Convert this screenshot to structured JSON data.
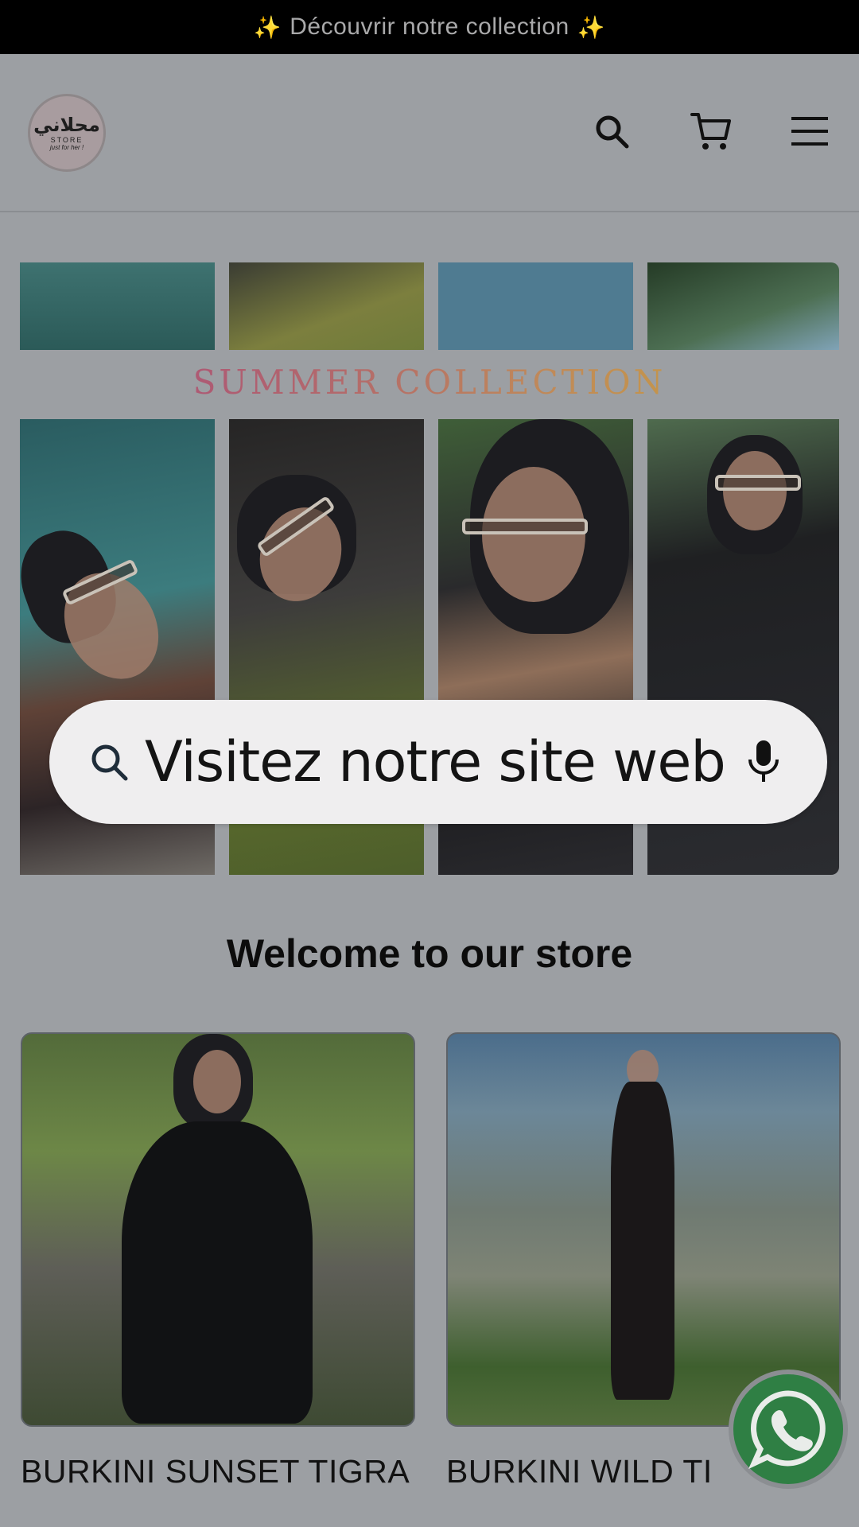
{
  "announcement": {
    "left_icon": "sparkles-icon",
    "text": "Découvrir notre collection",
    "right_icon": "sparkles-icon"
  },
  "header": {
    "logo": {
      "arabic": "محلاني",
      "store": "STORE",
      "tagline": "just for her !"
    },
    "icons": [
      "search-icon",
      "cart-icon",
      "menu-icon"
    ]
  },
  "hero": {
    "banner_text": "SUMMER COLLECTION",
    "search_overlay": {
      "text": "Visitez notre site web",
      "left_icon": "search-icon",
      "right_icon": "microphone-icon"
    }
  },
  "section": {
    "title": "Welcome to our store"
  },
  "products": [
    {
      "title": "BURKINI SUNSET TIGRA"
    },
    {
      "title": "BURKINI WILD TI"
    }
  ],
  "floating": {
    "icon": "whatsapp-icon"
  },
  "colors": {
    "announcement_bg": "#000000",
    "page_overlay": "#9c9fa3",
    "whatsapp": "#2f7f44"
  }
}
